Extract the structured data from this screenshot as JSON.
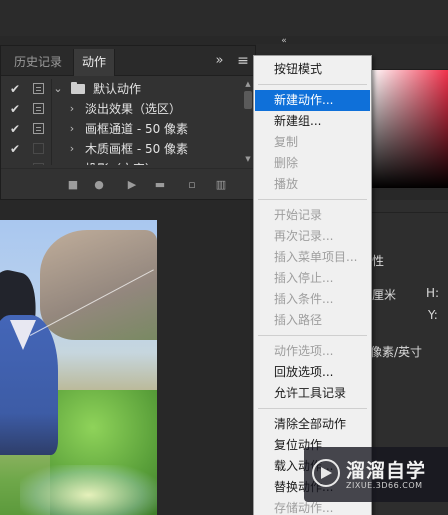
{
  "panel": {
    "tabs": [
      {
        "label": "历史记录",
        "active": false
      },
      {
        "label": "动作",
        "active": true
      }
    ],
    "expand_icon": "»",
    "menu_icon": "≡"
  },
  "actions": [
    {
      "checked": true,
      "dialog": true,
      "expanded": true,
      "is_set": true,
      "label": "默认动作"
    },
    {
      "checked": true,
      "dialog": true,
      "expanded": false,
      "is_set": false,
      "label": "淡出效果（选区）"
    },
    {
      "checked": true,
      "dialog": true,
      "expanded": false,
      "is_set": false,
      "label": "画框通道 - 50 像素"
    },
    {
      "checked": true,
      "dialog": false,
      "expanded": false,
      "is_set": false,
      "label": "木质画框 - 50 像素"
    },
    {
      "checked": true,
      "dialog": false,
      "expanded": false,
      "is_set": false,
      "label": "投影（文字）"
    }
  ],
  "bottom_buttons": [
    {
      "name": "stop-icon",
      "glyph": "■"
    },
    {
      "name": "record-icon",
      "glyph": "●"
    },
    {
      "name": "play-icon",
      "glyph": "▶"
    },
    {
      "name": "new-set-folder-icon",
      "glyph": "▬"
    },
    {
      "name": "new-action-icon",
      "glyph": "▫"
    },
    {
      "name": "trash-icon",
      "glyph": "▥"
    }
  ],
  "context_menu": {
    "items": [
      {
        "label": "按钮模式",
        "enabled": true,
        "highlighted": false
      },
      {
        "separator": true
      },
      {
        "label": "新建动作...",
        "enabled": true,
        "highlighted": true
      },
      {
        "label": "新建组...",
        "enabled": true,
        "highlighted": false
      },
      {
        "label": "复制",
        "enabled": false,
        "highlighted": false
      },
      {
        "label": "删除",
        "enabled": false,
        "highlighted": false
      },
      {
        "label": "播放",
        "enabled": false,
        "highlighted": false
      },
      {
        "separator": true
      },
      {
        "label": "开始记录",
        "enabled": false,
        "highlighted": false
      },
      {
        "label": "再次记录...",
        "enabled": false,
        "highlighted": false
      },
      {
        "label": "插入菜单项目...",
        "enabled": false,
        "highlighted": false
      },
      {
        "label": "插入停止...",
        "enabled": false,
        "highlighted": false
      },
      {
        "label": "插入条件...",
        "enabled": false,
        "highlighted": false
      },
      {
        "label": "插入路径",
        "enabled": false,
        "highlighted": false
      },
      {
        "separator": true
      },
      {
        "label": "动作选项...",
        "enabled": false,
        "highlighted": false
      },
      {
        "label": "回放选项...",
        "enabled": true,
        "highlighted": false
      },
      {
        "label": "允许工具记录",
        "enabled": true,
        "highlighted": false
      },
      {
        "separator": true
      },
      {
        "label": "清除全部动作",
        "enabled": true,
        "highlighted": false
      },
      {
        "label": "复位动作",
        "enabled": true,
        "highlighted": false
      },
      {
        "label": "载入动作...",
        "enabled": true,
        "highlighted": false
      },
      {
        "label": "替换动作...",
        "enabled": true,
        "highlighted": false
      },
      {
        "label": "存储动作...",
        "enabled": false,
        "highlighted": false
      }
    ]
  },
  "right_panel": {
    "collapse_icon": "«",
    "fragment_property": "性",
    "fragment_cm": "厘米",
    "fragment_h": "H:",
    "fragment_y": "Y:",
    "fragment_resolution": "像素/英寸"
  },
  "watermark": {
    "title": "溜溜自学",
    "url": "ZIXUE.3D66.COM"
  }
}
